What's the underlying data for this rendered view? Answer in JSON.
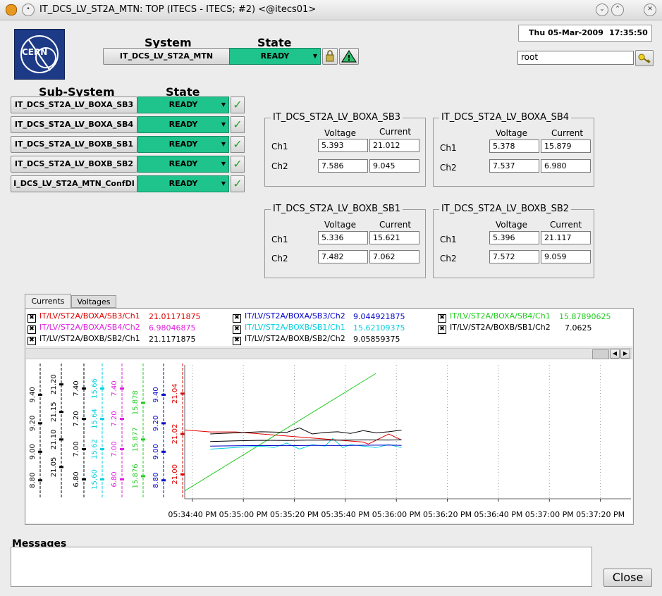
{
  "window": {
    "title": "IT_DCS_LV_ST2A_MTN: TOP (ITECS - ITECS; #2) <@itecs01>"
  },
  "header": {
    "logo_text": "CERN",
    "system_header": "System",
    "state_header": "State",
    "system_name": "IT_DCS_LV_ST2A_MTN",
    "system_state": "READY",
    "datetime_date": "Thu 05-Mar-2009",
    "datetime_time": "17:35:50",
    "user": "root"
  },
  "subsystems": {
    "header": "Sub-System",
    "state_header": "State",
    "items": [
      {
        "name": "IT_DCS_ST2A_LV_BOXA_SB3",
        "state": "READY"
      },
      {
        "name": "IT_DCS_ST2A_LV_BOXA_SB4",
        "state": "READY"
      },
      {
        "name": "IT_DCS_ST2A_LV_BOXB_SB1",
        "state": "READY"
      },
      {
        "name": "IT_DCS_ST2A_LV_BOXB_SB2",
        "state": "READY"
      },
      {
        "name": "I_DCS_LV_ST2A_MTN_ConfDI",
        "state": "READY"
      }
    ]
  },
  "boxes": [
    {
      "title": "IT_DCS_ST2A_LV_BOXA_SB3",
      "voltage_label": "Voltage",
      "current_label": "Current",
      "ch1_label": "Ch1",
      "ch2_label": "Ch2",
      "ch1_voltage": "5.393",
      "ch1_current": "21.012",
      "ch2_voltage": "7.586",
      "ch2_current": "9.045"
    },
    {
      "title": "IT_DCS_ST2A_LV_BOXA_SB4",
      "voltage_label": "Voltage",
      "current_label": "Current",
      "ch1_label": "Ch1",
      "ch2_label": "Ch2",
      "ch1_voltage": "5.378",
      "ch1_current": "15.879",
      "ch2_voltage": "7.537",
      "ch2_current": "6.980"
    },
    {
      "title": "IT_DCS_ST2A_LV_BOXB_SB1",
      "voltage_label": "Voltage",
      "current_label": "Current",
      "ch1_label": "Ch1",
      "ch2_label": "Ch2",
      "ch1_voltage": "5.336",
      "ch1_current": "15.621",
      "ch2_voltage": "7.482",
      "ch2_current": "7.062"
    },
    {
      "title": "IT_DCS_ST2A_LV_BOXB_SB2",
      "voltage_label": "Voltage",
      "current_label": "Current",
      "ch1_label": "Ch1",
      "ch2_label": "Ch2",
      "ch1_voltage": "5.396",
      "ch1_current": "21.117",
      "ch2_voltage": "7.572",
      "ch2_current": "9.059"
    }
  ],
  "tabs": [
    {
      "label": "Currents",
      "active": true
    },
    {
      "label": "Voltages",
      "active": false
    }
  ],
  "legend": [
    {
      "name": "IT/LV/ST2A/BOXA/SB3/Ch1",
      "value": "21.01171875",
      "color": "#e00000"
    },
    {
      "name": "IT/LV/ST2A/BOXA/SB3/Ch2",
      "value": "9.044921875",
      "color": "#0000cc"
    },
    {
      "name": "IT/LV/ST2A/BOXA/SB4/Ch1",
      "value": "15.87890625",
      "color": "#22cc22"
    },
    {
      "name": "IT/LV/ST2A/BOXA/SB4/Ch2",
      "value": "6.98046875",
      "color": "#e020e0"
    },
    {
      "name": "IT/LV/ST2A/BOXB/SB1/Ch1",
      "value": "15.62109375",
      "color": "#00d0e0"
    },
    {
      "name": "IT/LV/ST2A/BOXB/SB1/Ch2",
      "value": "7.0625",
      "color": "#000000"
    },
    {
      "name": "IT/LV/ST2A/BOXB/SB2/Ch1",
      "value": "21.1171875",
      "color": "#000000"
    },
    {
      "name": "IT/LV/ST2A/BOXB/SB2/Ch2",
      "value": "9.05859375",
      "color": "#000000"
    }
  ],
  "chart_data": {
    "type": "line",
    "x_ticks": [
      "05:34:40 PM",
      "05:35:00 PM",
      "05:35:20 PM",
      "05:35:40 PM",
      "05:36:00 PM",
      "05:36:20 PM",
      "05:36:40 PM",
      "05:37:00 PM",
      "05:37:20 PM"
    ],
    "xlim_seconds": [
      0,
      175
    ],
    "axes": [
      {
        "color": "#000000",
        "ticks": [
          "8.80",
          "9.00",
          "9.20",
          "9.40"
        ],
        "range": [
          8.7,
          9.55
        ]
      },
      {
        "color": "#000000",
        "ticks": [
          "21.05",
          "21.10",
          "21.15",
          "21.20"
        ],
        "range": [
          21.0,
          21.22
        ]
      },
      {
        "color": "#000000",
        "ticks": [
          "6.80",
          "7.00",
          "7.20",
          "7.40"
        ],
        "range": [
          6.7,
          7.5
        ]
      },
      {
        "color": "#00d0e0",
        "ticks": [
          "15.60",
          "15.62",
          "15.64",
          "15.66"
        ],
        "range": [
          15.59,
          15.67
        ]
      },
      {
        "color": "#e020e0",
        "ticks": [
          "6.80",
          "7.00",
          "7.20",
          "7.40"
        ],
        "range": [
          6.7,
          7.5
        ]
      },
      {
        "color": "#22cc22",
        "ticks": [
          "15.876",
          "15.877",
          "15.878"
        ],
        "range": [
          15.8755,
          15.8788
        ]
      },
      {
        "color": "#0000cc",
        "ticks": [
          "8.80",
          "9.00",
          "9.20",
          "9.40"
        ],
        "range": [
          8.7,
          9.55
        ]
      },
      {
        "color": "#e00000",
        "ticks": [
          "21.00",
          "21.02",
          "21.04"
        ],
        "range": [
          20.99,
          21.05
        ]
      }
    ],
    "series": [
      {
        "name": "IT/LV/ST2A/BOXA/SB4/Ch1",
        "color": "#22cc22",
        "x": [
          0,
          75
        ],
        "y": [
          15.8756,
          15.8788
        ]
      },
      {
        "name": "IT/LV/ST2A/BOXA/SB3/Ch1",
        "color": "#e00000",
        "x": [
          0,
          10,
          20,
          30,
          40,
          50,
          60,
          70,
          72,
          80,
          85
        ],
        "y": [
          21.022,
          21.021,
          21.021,
          21.02,
          21.019,
          21.018,
          21.017,
          21.016,
          21.015,
          21.02,
          21.017
        ]
      },
      {
        "name": "IT/LV/ST2A/BOXB/SB1/Ch1",
        "color": "#00d0e0",
        "x": [
          10,
          20,
          30,
          35,
          40,
          45,
          50,
          55,
          58,
          62,
          65,
          70,
          75,
          80,
          85
        ],
        "y": [
          15.62,
          15.621,
          15.622,
          15.621,
          15.624,
          15.62,
          15.623,
          15.622,
          15.627,
          15.621,
          15.623,
          15.622,
          15.621,
          15.623,
          15.621
        ]
      },
      {
        "name": "IT/LV/ST2A/BOXA/SB3/Ch2",
        "color": "#0000cc",
        "x": [
          10,
          20,
          30,
          40,
          50,
          60,
          70,
          80,
          85
        ],
        "y": [
          9.04,
          9.042,
          9.044,
          9.043,
          9.045,
          9.044,
          9.046,
          9.047,
          9.045
        ]
      },
      {
        "name": "IT/LV/ST2A/BOXB/SB2/Ch1",
        "color": "#000000",
        "x": [
          10,
          20,
          30,
          40,
          45,
          50,
          55,
          60,
          65,
          70,
          75,
          80,
          85
        ],
        "y": [
          21.11,
          21.112,
          21.114,
          21.113,
          21.121,
          21.11,
          21.113,
          21.114,
          21.111,
          21.116,
          21.112,
          21.114,
          21.117
        ]
      },
      {
        "name": "IT/LV/ST2A/BOXB/SB1/Ch2",
        "color": "#000000",
        "x": [
          10,
          20,
          30,
          40,
          50,
          60,
          70,
          80,
          85
        ],
        "y": [
          7.05,
          7.055,
          7.058,
          7.057,
          7.06,
          7.059,
          7.061,
          7.06,
          7.062
        ]
      }
    ]
  },
  "messages": {
    "label": "Messages",
    "close_label": "Close"
  }
}
